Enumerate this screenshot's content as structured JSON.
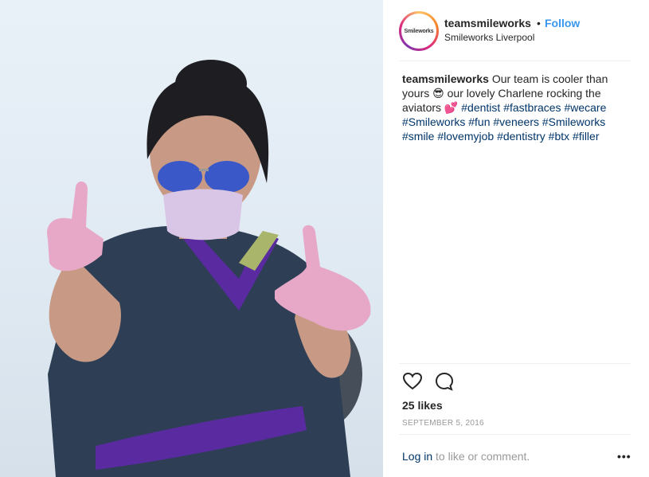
{
  "post": {
    "username": "teamsmileworks",
    "follow_label": "Follow",
    "separator": "•",
    "location": "Smileworks Liverpool",
    "avatar_text": "Smileworks",
    "caption": {
      "text_before": " Our team is cooler than yours ",
      "emoji_1": "😎",
      "text_middle": " our lovely Charlene rocking the aviators ",
      "emoji_2": "💕",
      "hashtags": [
        "#dentist",
        "#fastbraces",
        "#wecare",
        "#Smileworks",
        "#fun",
        "#veneers",
        "#Smileworks",
        "#smile",
        "#lovemyjob",
        "#dentistry",
        "#btx",
        "#filler"
      ]
    },
    "likes": "25 likes",
    "date": "SEPTEMBER 5, 2016",
    "login_link": "Log in",
    "login_rest": " to like or comment.",
    "more_label": "•••",
    "icons": {
      "like": "heart-icon",
      "comment": "comment-bubble-icon",
      "more": "more-options-icon"
    },
    "colors": {
      "link": "#3897f0",
      "hashtag": "#003569",
      "muted": "#999999"
    }
  }
}
